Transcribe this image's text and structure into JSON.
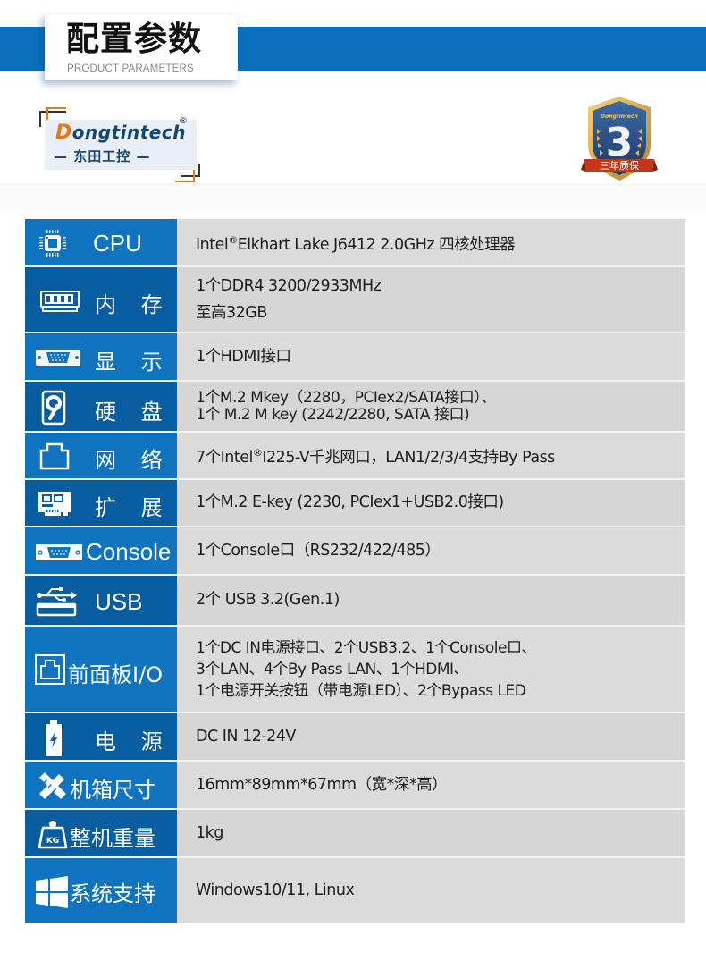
{
  "header": {
    "title_cn": "配置参数",
    "title_en": "PRODUCT PARAMETERS"
  },
  "logo": {
    "brand_en_initial": "D",
    "brand_en_rest": "ongtintech",
    "registered": "®",
    "brand_cn": "— 东田工控 —"
  },
  "badge": {
    "brand": "Dongtintech",
    "number": "3",
    "ribbon": "三年质保"
  },
  "colors": {
    "band_blue": "#0a6fbd",
    "label_blue": "#0f73bf",
    "label_blue_dark": "#075da0",
    "value_gray": "#dcdbdb",
    "logo_orange": "#e57818",
    "logo_navy": "#16456f"
  },
  "specs": [
    {
      "key": "cpu",
      "icon": "cpu-chip-icon",
      "label": "CPU",
      "lines": [
        "Intel®Elkhart Lake J6412 2.0GHz 四核处理器"
      ]
    },
    {
      "key": "memory",
      "icon": "ram-module-icon",
      "label": "内 存",
      "lines": [
        "1个DDR4 3200/2933MHz",
        "至高32GB"
      ]
    },
    {
      "key": "display",
      "icon": "vga-port-icon",
      "label": "显 示",
      "lines": [
        "1个HDMI接口"
      ]
    },
    {
      "key": "storage",
      "icon": "hard-disk-icon",
      "label": "硬 盘",
      "lines": [
        "1个M.2 Mkey（2280，PCIex2/SATA接口）、",
        "1个 M.2 M key (2242/2280, SATA 接口)"
      ]
    },
    {
      "key": "network",
      "icon": "ethernet-port-icon",
      "label": "网 络",
      "lines": [
        "7个Intel®I225-V千兆网口，LAN1/2/3/4支持By Pass"
      ]
    },
    {
      "key": "expansion",
      "icon": "expansion-card-icon",
      "label": "扩 展",
      "lines": [
        "1个M.2 E-key (2230, PCIex1+USB2.0接口)"
      ]
    },
    {
      "key": "console",
      "icon": "serial-port-icon",
      "label": "Console",
      "lines": [
        "1个Console口（RS232/422/485）"
      ]
    },
    {
      "key": "usb",
      "icon": "usb-icon",
      "label": "USB",
      "lines": [
        "2个 USB 3.2(Gen.1)"
      ]
    },
    {
      "key": "front_io",
      "icon": "front-panel-icon",
      "label": "前面板I/O",
      "lines": [
        "1个DC IN电源接口、2个USB3.2、1个Console口、",
        "3个LAN、4个By Pass LAN、1个HDMI、",
        "1个电源开关按钮（带电源LED）、2个Bypass LED"
      ]
    },
    {
      "key": "power",
      "icon": "battery-bolt-icon",
      "label": "电 源",
      "lines": [
        "DC IN 12-24V"
      ]
    },
    {
      "key": "chassis",
      "icon": "ruler-pencil-icon",
      "label": "机箱尺寸",
      "lines": [
        "16mm*89mm*67mm（宽*深*高）"
      ]
    },
    {
      "key": "weight",
      "icon": "weight-kg-icon",
      "label": "整机重量",
      "lines": [
        "1kg"
      ]
    },
    {
      "key": "os",
      "icon": "windows-logo-icon",
      "label": "系统支持",
      "lines": [
        "Windows10/11, Linux"
      ]
    }
  ]
}
